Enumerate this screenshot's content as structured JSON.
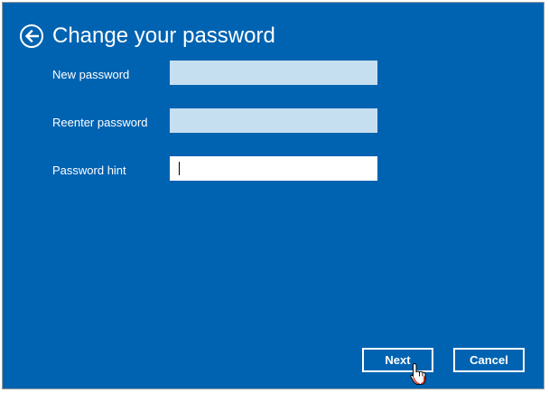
{
  "header": {
    "title": "Change your password",
    "back_icon": "back-arrow-icon"
  },
  "form": {
    "new_password_label": "New password",
    "reenter_password_label": "Reenter password",
    "password_hint_label": "Password hint",
    "new_password_value": "",
    "reenter_password_value": "",
    "password_hint_value": ""
  },
  "buttons": {
    "next_label": "Next",
    "cancel_label": "Cancel"
  },
  "colors": {
    "background": "#0063b1",
    "disabled_field": "#c6dff0",
    "text": "#ffffff"
  }
}
